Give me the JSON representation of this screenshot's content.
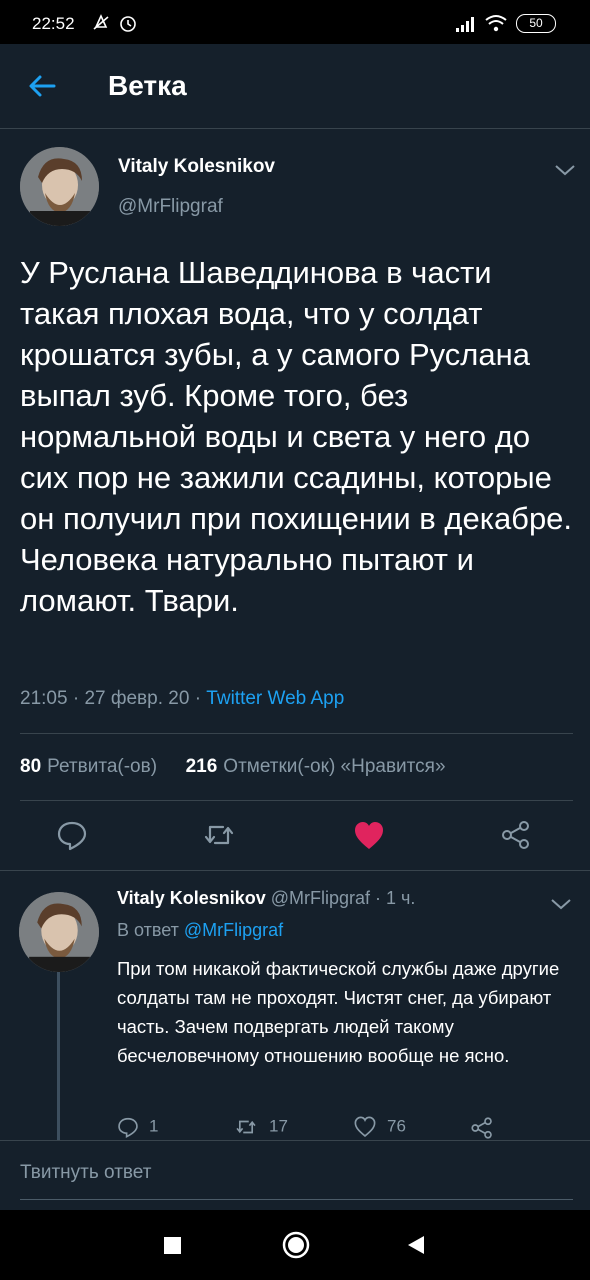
{
  "status_bar": {
    "time": "22:52",
    "battery": "50",
    "icons": [
      "alarm-off-icon",
      "alarm-clock-icon",
      "signal-icon",
      "wifi-icon",
      "battery-icon"
    ]
  },
  "app_bar": {
    "title": "Ветка",
    "back_icon": "arrow-left-icon"
  },
  "main_tweet": {
    "author_name": "Vitaly Kolesnikov",
    "author_handle": "@MrFlipgraf",
    "text": "У Руслана Шаведдинова в части такая плохая вода, что у солдат крошатся зубы, а у самого Руслана выпал зуб. Кроме того, без нормальной воды и света у него до сих пор не зажили ссадины, которые он получил при похищении в декабре. Человека натурально пытают и ломают. Твари.",
    "time": "21:05",
    "date": "27 февр. 20",
    "separator": "·",
    "source": "Twitter Web App",
    "retweets_count": "80",
    "retweets_label": "Ретвита(-ов)",
    "likes_count": "216",
    "likes_label": "Отметки(-ок) «Нравится»",
    "liked": true,
    "colors": {
      "like": "#e0245e",
      "accent": "#1da1f2",
      "background": "#15202b"
    }
  },
  "reply_tweet": {
    "author_name": "Vitaly Kolesnikov",
    "author_handle": "@MrFlipgraf",
    "time_ago": "· 1 ч.",
    "in_reply_prefix": "В ответ",
    "in_reply_handle": "@MrFlipgraf",
    "text": "При том никакой фактической службы даже другие солдаты там не проходят. Чистят снег, да убирают часть. Зачем подвергать людей такому бесчеловечному отношению вообще не ясно.",
    "replies": "1",
    "retweets": "17",
    "likes": "76"
  },
  "reply_input": {
    "placeholder": "Твитнуть ответ"
  },
  "nav_bar": {
    "buttons": [
      "recents-square-icon",
      "home-circle-icon",
      "back-triangle-icon"
    ]
  }
}
